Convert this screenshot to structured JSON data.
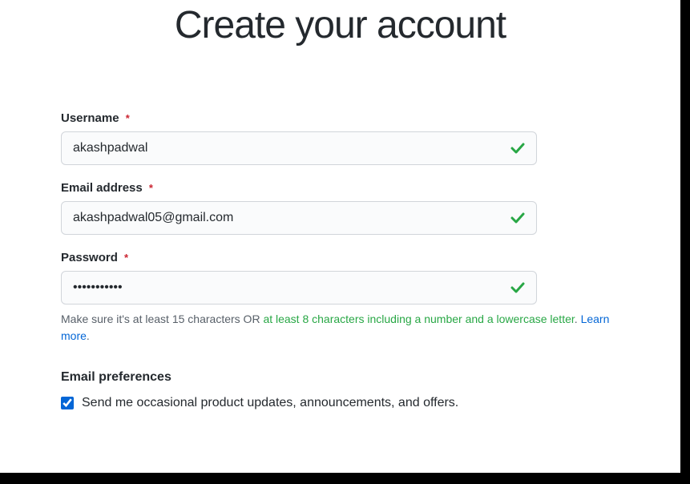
{
  "page": {
    "title": "Create your account"
  },
  "form": {
    "username": {
      "label": "Username",
      "required_mark": "*",
      "value": "akashpadwal"
    },
    "email": {
      "label": "Email address",
      "required_mark": "*",
      "value": "akashpadwal05@gmail.com"
    },
    "password": {
      "label": "Password",
      "required_mark": "*",
      "value": "•••••••••••",
      "hint_prefix": "Make sure it's at least 15 characters OR ",
      "hint_green": "at least 8 characters including a number and a lowercase letter",
      "hint_period": ". ",
      "learn_more": "Learn more",
      "hint_end": "."
    },
    "email_prefs": {
      "heading": "Email preferences",
      "checkbox_label": "Send me occasional product updates, announcements, and offers."
    }
  }
}
